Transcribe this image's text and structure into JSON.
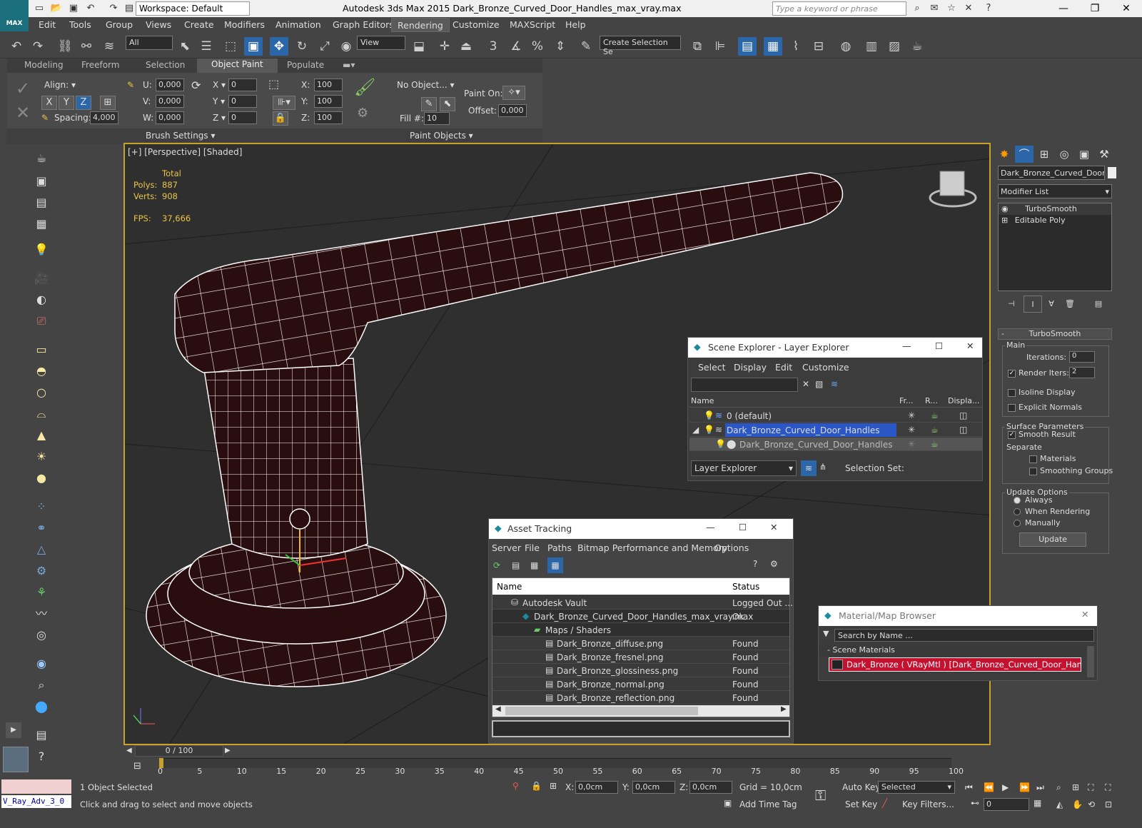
{
  "app": {
    "logo": "MAX",
    "title": "Autodesk 3ds Max  2015     Dark_Bronze_Curved_Door_Handles_max_vray.max",
    "workspace": "Workspace: Default",
    "search_placeholder": "Type a keyword or phrase"
  },
  "menu": [
    "Edit",
    "Tools",
    "Group",
    "Views",
    "Create",
    "Modifiers",
    "Animation",
    "Graph Editors",
    "Rendering",
    "Customize",
    "MAXScript",
    "Help"
  ],
  "toolbar": {
    "filter": "All",
    "refcoord": "View",
    "selset": "Create Selection Se"
  },
  "ribbon": {
    "tabs": [
      "Modeling",
      "Freeform",
      "Selection",
      "Object Paint",
      "Populate"
    ],
    "active_tab": "Object Paint",
    "align": "Align:",
    "spacing_label": "Spacing:",
    "spacing": "4,000",
    "u_label": "U:",
    "u": "0,000",
    "v_label": "V:",
    "v": "0,000",
    "w_label": "W:",
    "w": "0,000",
    "x_label": "X",
    "x": "0",
    "y_label": "Y",
    "y": "0",
    "z_label": "Z",
    "z": "0",
    "sx_label": "X:",
    "sx": "100",
    "sy_label": "Y:",
    "sy": "100",
    "sz_label": "Z:",
    "sz": "100",
    "no_object": "No Object...",
    "fill_label": "Fill #:",
    "fill": "10",
    "paint_on": "Paint On:",
    "offset_label": "Offset:",
    "offset": "0,000",
    "brush_settings": "Brush Settings",
    "paint_objects": "Paint Objects"
  },
  "viewport": {
    "label": "[+] [Perspective] [Shaded]",
    "stats_header": "Total",
    "polys_label": "Polys:",
    "polys": "887",
    "verts_label": "Verts:",
    "verts": "908",
    "fps_label": "FPS:",
    "fps": "37,666"
  },
  "command_panel": {
    "object_name": "Dark_Bronze_Curved_Door_H",
    "modifier_list": "Modifier List",
    "stack": [
      "TurboSmooth",
      "Editable Poly"
    ],
    "rollout": "TurboSmooth",
    "main": "Main",
    "iterations_label": "Iterations:",
    "iterations": "0",
    "render_iters_label": "Render Iters:",
    "render_iters": "2",
    "isoline": "Isoline Display",
    "explicit_normals": "Explicit Normals",
    "surface_params": "Surface Parameters",
    "smooth_result": "Smooth Result",
    "separate": "Separate",
    "materials": "Materials",
    "smoothing_groups": "Smoothing Groups",
    "update_options": "Update Options",
    "always": "Always",
    "when_rendering": "When Rendering",
    "manually": "Manually",
    "update": "Update"
  },
  "scene_explorer": {
    "title": "Scene Explorer - Layer Explorer",
    "menu": [
      "Select",
      "Display",
      "Edit",
      "Customize"
    ],
    "columns": [
      "Name",
      "Fr...",
      "R...",
      "Displa..."
    ],
    "rows": [
      "0 (default)",
      "Dark_Bronze_Curved_Door_Handles",
      "Dark_Bronze_Curved_Door_Handles"
    ],
    "footer_mode": "Layer Explorer",
    "selection_set": "Selection Set:"
  },
  "asset_tracking": {
    "title": "Asset Tracking",
    "menu": [
      "Server",
      "File",
      "Paths",
      "Bitmap Performance and Memory",
      "Options"
    ],
    "columns": [
      "Name",
      "Status"
    ],
    "rows": [
      {
        "name": "Autodesk Vault",
        "status": "Logged Out ..."
      },
      {
        "name": "Dark_Bronze_Curved_Door_Handles_max_vray.max",
        "status": "Ok"
      },
      {
        "name": "Maps / Shaders",
        "status": ""
      },
      {
        "name": "Dark_Bronze_diffuse.png",
        "status": "Found"
      },
      {
        "name": "Dark_Bronze_fresnel.png",
        "status": "Found"
      },
      {
        "name": "Dark_Bronze_glossiness.png",
        "status": "Found"
      },
      {
        "name": "Dark_Bronze_normal.png",
        "status": "Found"
      },
      {
        "name": "Dark_Bronze_reflection.png",
        "status": "Found"
      }
    ]
  },
  "material_browser": {
    "title": "Material/Map Browser",
    "search": "Search by Name ...",
    "section": "- Scene Materials",
    "item": "Dark_Bronze ( VRayMtl ) [Dark_Bronze_Curved_Door_Handles]"
  },
  "timeline": {
    "frame": "0 / 100",
    "ticks": [
      "0",
      "5",
      "10",
      "15",
      "20",
      "25",
      "30",
      "35",
      "40",
      "45",
      "50",
      "55",
      "60",
      "65",
      "70",
      "75",
      "80",
      "85",
      "90",
      "95",
      "100"
    ]
  },
  "status": {
    "script": "V_Ray_Adv_3_0",
    "selected": "1 Object Selected",
    "hint": "Click and drag to select and move objects",
    "x_label": "X:",
    "x": "0,0cm",
    "y_label": "Y:",
    "y": "0,0cm",
    "z_label": "Z:",
    "z": "0,0cm",
    "grid": "Grid = 10,0cm",
    "add_time_tag": "Add Time Tag",
    "auto_key": "Auto Key",
    "set_key": "Set Key",
    "selected_mode": "Selected",
    "key_filters": "Key Filters...",
    "frame": "0"
  }
}
